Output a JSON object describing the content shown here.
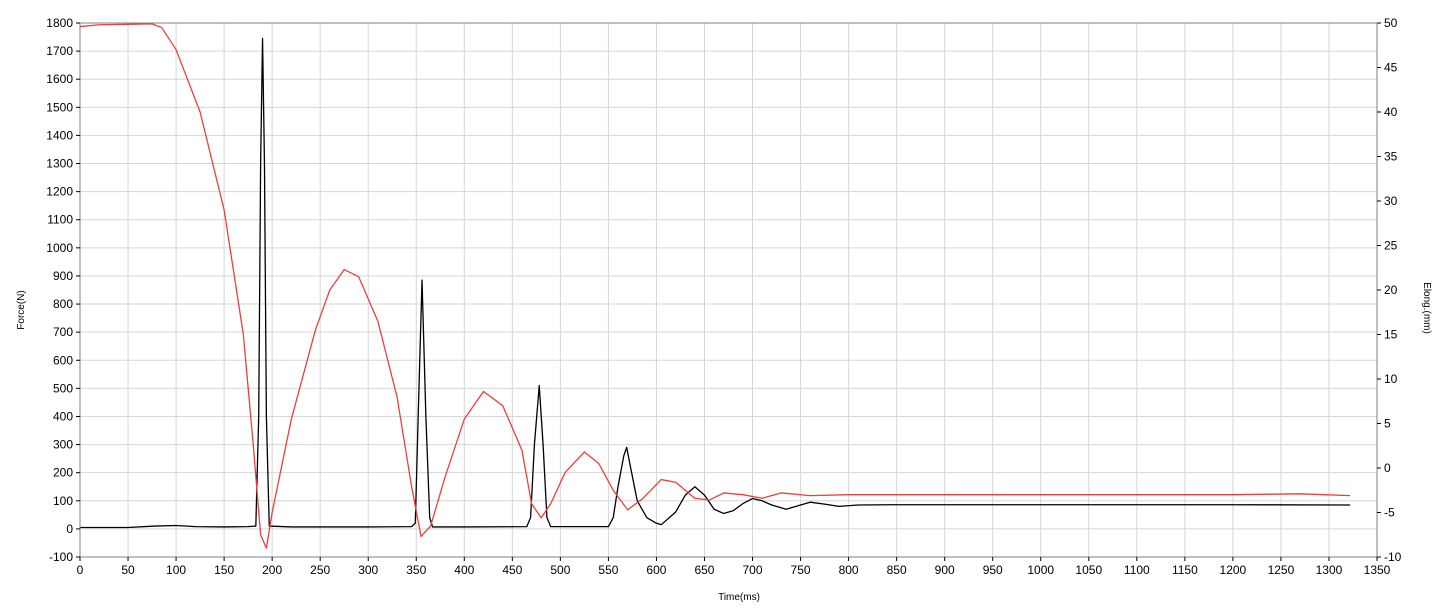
{
  "chart_data": {
    "type": "line",
    "xlabel": "Time(ms)",
    "ylabel_left": "Force(N)",
    "ylabel_right": "Elong.(mm)",
    "xlim": [
      0,
      1350
    ],
    "ylim_left": [
      -100,
      1800
    ],
    "ylim_right": [
      -10,
      50
    ],
    "x_ticks": [
      0,
      50,
      100,
      150,
      200,
      250,
      300,
      350,
      400,
      450,
      500,
      550,
      600,
      650,
      700,
      750,
      800,
      850,
      900,
      950,
      1000,
      1050,
      1100,
      1150,
      1200,
      1250,
      1300,
      1350
    ],
    "y_left_ticks": [
      -100,
      0,
      100,
      200,
      300,
      400,
      500,
      600,
      700,
      800,
      900,
      1000,
      1100,
      1200,
      1300,
      1400,
      1500,
      1600,
      1700,
      1800
    ],
    "y_right_ticks": [
      -10,
      -5,
      0,
      5,
      10,
      15,
      20,
      25,
      30,
      35,
      40,
      45,
      50
    ],
    "grid": true,
    "colors": {
      "force": "#000000",
      "elongation": "#e8403c",
      "grid": "#d6d6d6",
      "frame": "#808080"
    },
    "series": [
      {
        "key": "force",
        "axis": "left",
        "points": [
          [
            0,
            5
          ],
          [
            50,
            5
          ],
          [
            78,
            10
          ],
          [
            100,
            12
          ],
          [
            120,
            8
          ],
          [
            150,
            7
          ],
          [
            175,
            8
          ],
          [
            183,
            10
          ],
          [
            186,
            400
          ],
          [
            188,
            1300
          ],
          [
            190,
            1745
          ],
          [
            192,
            1300
          ],
          [
            194,
            400
          ],
          [
            197,
            10
          ],
          [
            220,
            7
          ],
          [
            300,
            7
          ],
          [
            345,
            8
          ],
          [
            349,
            20
          ],
          [
            352,
            400
          ],
          [
            356,
            885
          ],
          [
            360,
            400
          ],
          [
            364,
            40
          ],
          [
            367,
            7
          ],
          [
            400,
            7
          ],
          [
            465,
            8
          ],
          [
            469,
            40
          ],
          [
            473,
            300
          ],
          [
            478,
            510
          ],
          [
            482,
            300
          ],
          [
            486,
            40
          ],
          [
            490,
            8
          ],
          [
            550,
            8
          ],
          [
            555,
            40
          ],
          [
            560,
            150
          ],
          [
            566,
            260
          ],
          [
            569,
            290
          ],
          [
            573,
            220
          ],
          [
            580,
            100
          ],
          [
            590,
            40
          ],
          [
            600,
            20
          ],
          [
            605,
            15
          ],
          [
            620,
            60
          ],
          [
            630,
            120
          ],
          [
            640,
            150
          ],
          [
            650,
            120
          ],
          [
            660,
            70
          ],
          [
            670,
            55
          ],
          [
            680,
            65
          ],
          [
            690,
            90
          ],
          [
            700,
            108
          ],
          [
            710,
            100
          ],
          [
            720,
            85
          ],
          [
            735,
            70
          ],
          [
            750,
            85
          ],
          [
            760,
            95
          ],
          [
            775,
            88
          ],
          [
            790,
            80
          ],
          [
            810,
            85
          ],
          [
            850,
            86
          ],
          [
            1000,
            86
          ],
          [
            1200,
            86
          ],
          [
            1322,
            85
          ]
        ]
      },
      {
        "key": "elongation",
        "axis": "right",
        "points": [
          [
            0,
            49.6
          ],
          [
            20,
            49.8
          ],
          [
            75,
            49.9
          ],
          [
            85,
            49.5
          ],
          [
            100,
            47.0
          ],
          [
            125,
            40.0
          ],
          [
            150,
            29.0
          ],
          [
            170,
            15.0
          ],
          [
            180,
            3.0
          ],
          [
            188,
            -7.5
          ],
          [
            194,
            -9.0
          ],
          [
            200,
            -5.0
          ],
          [
            220,
            5.5
          ],
          [
            245,
            15.5
          ],
          [
            260,
            20.0
          ],
          [
            275,
            22.3
          ],
          [
            290,
            21.5
          ],
          [
            310,
            16.5
          ],
          [
            330,
            8.0
          ],
          [
            345,
            -2.0
          ],
          [
            355,
            -7.7
          ],
          [
            365,
            -6.5
          ],
          [
            380,
            -1.0
          ],
          [
            400,
            5.5
          ],
          [
            420,
            8.6
          ],
          [
            440,
            7.0
          ],
          [
            460,
            2.0
          ],
          [
            470,
            -4.0
          ],
          [
            480,
            -5.6
          ],
          [
            490,
            -4.0
          ],
          [
            505,
            -0.5
          ],
          [
            525,
            1.8
          ],
          [
            540,
            0.5
          ],
          [
            555,
            -2.5
          ],
          [
            570,
            -4.7
          ],
          [
            585,
            -3.5
          ],
          [
            605,
            -1.3
          ],
          [
            620,
            -1.6
          ],
          [
            640,
            -3.4
          ],
          [
            655,
            -3.6
          ],
          [
            670,
            -2.8
          ],
          [
            690,
            -3.0
          ],
          [
            710,
            -3.4
          ],
          [
            730,
            -2.8
          ],
          [
            760,
            -3.1
          ],
          [
            800,
            -3.0
          ],
          [
            900,
            -3.0
          ],
          [
            1000,
            -3.0
          ],
          [
            1100,
            -3.0
          ],
          [
            1200,
            -3.0
          ],
          [
            1270,
            -2.9
          ],
          [
            1322,
            -3.1
          ]
        ]
      }
    ]
  }
}
